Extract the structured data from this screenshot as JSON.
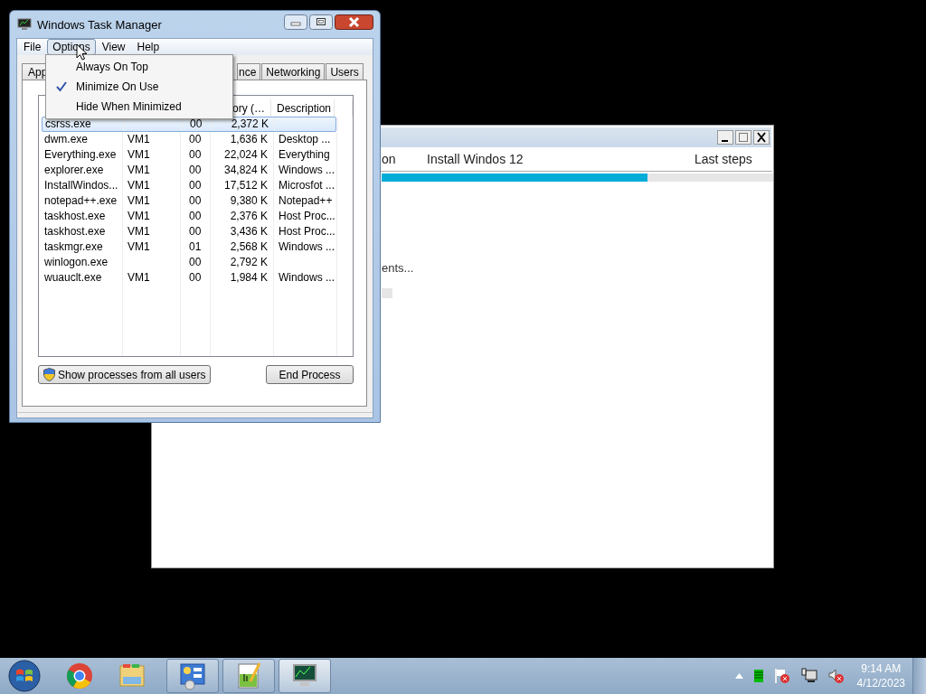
{
  "installer": {
    "steps": [
      {
        "label": "on"
      },
      {
        "label": "Install Windos 12"
      },
      {
        "label": "Last steps"
      }
    ],
    "progress": {
      "level": 0.68
    },
    "status_text": "ents..."
  },
  "task_manager": {
    "title": "Windows Task Manager",
    "menu": [
      {
        "label": "File",
        "selected": false
      },
      {
        "label": "Options",
        "selected": true
      },
      {
        "label": "View",
        "selected": false
      },
      {
        "label": "Help",
        "selected": false
      }
    ],
    "options_menu": [
      {
        "label": "Always On Top",
        "checked": false
      },
      {
        "label": "Minimize On Use",
        "checked": true
      },
      {
        "label": "Hide When Minimized",
        "checked": false
      }
    ],
    "tabs": [
      {
        "label": "App",
        "selected": false
      },
      {
        "label": "nce",
        "selected": false
      },
      {
        "label": "Networking",
        "selected": false
      },
      {
        "label": "Users",
        "selected": false
      }
    ],
    "table": {
      "header": {
        "column_4": "ory (…",
        "column_5": "Description"
      },
      "rows": [
        {
          "column_1": "csrss.exe",
          "column_3": "00",
          "column_4": "2,372 K",
          "selected": true
        },
        {
          "column_1": "dwm.exe",
          "column_2": "VM1",
          "column_3": "00",
          "column_4": "1,636 K",
          "column_5": "Desktop ...",
          "selected": false
        },
        {
          "column_1": "Everything.exe",
          "column_2": "VM1",
          "column_3": "00",
          "column_4": "22,024 K",
          "column_5": "Everything",
          "selected": false
        },
        {
          "column_1": "explorer.exe",
          "column_2": "VM1",
          "column_3": "00",
          "column_4": "34,824 K",
          "column_5": "Windows ...",
          "selected": false
        },
        {
          "column_1": "InstallWindos...",
          "column_2": "VM1",
          "column_3": "00",
          "column_4": "17,512 K",
          "column_5": "Microsfot ...",
          "selected": false
        },
        {
          "column_1": "notepad++.exe",
          "column_2": "VM1",
          "column_3": "00",
          "column_4": "9,380 K",
          "column_5": "Notepad++",
          "selected": false
        },
        {
          "column_1": "taskhost.exe",
          "column_2": "VM1",
          "column_3": "00",
          "column_4": "2,376 K",
          "column_5": "Host Proc...",
          "selected": false
        },
        {
          "column_1": "taskhost.exe",
          "column_2": "VM1",
          "column_3": "00",
          "column_4": "3,436 K",
          "column_5": "Host Proc...",
          "selected": false
        },
        {
          "column_1": "taskmgr.exe",
          "column_2": "VM1",
          "column_3": "01",
          "column_4": "2,568 K",
          "column_5": "Windows ...",
          "selected": false
        },
        {
          "column_1": "winlogon.exe",
          "column_3": "00",
          "column_4": "2,792 K",
          "selected": false
        },
        {
          "column_1": "wuauclt.exe",
          "column_2": "VM1",
          "column_3": "00",
          "column_4": "1,984 K",
          "column_5": "Windows ...",
          "selected": false
        }
      ]
    },
    "buttons": [
      {
        "kind": "shield",
        "label": "Show processes from all users"
      },
      {
        "kind": "plain",
        "label": "End Process"
      }
    ]
  },
  "taskbar": {
    "apps": [
      {
        "kind": "chrome",
        "framed": false,
        "active": false
      },
      {
        "kind": "folder",
        "framed": false,
        "active": false
      },
      {
        "kind": "panel",
        "framed": true,
        "active": false
      },
      {
        "kind": "notepad",
        "framed": true,
        "active": false
      },
      {
        "kind": "monitor",
        "framed": true,
        "active": true
      }
    ],
    "clock": {
      "time": "9:14 AM",
      "date": "4/12/2023"
    }
  }
}
